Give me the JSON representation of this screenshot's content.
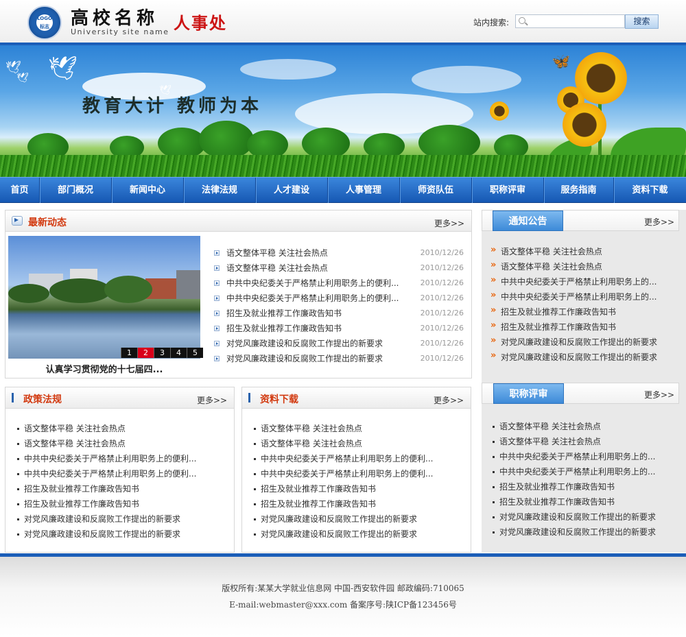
{
  "header": {
    "logo_text": "LOGO\n标志",
    "site_name": "高校名称",
    "site_name_en": "University site name",
    "department": "人事处",
    "search_label": "站内搜索:",
    "search_value": "",
    "search_button": "搜索"
  },
  "banner": {
    "slogan": "教育大计 教师为本"
  },
  "nav": [
    "首页",
    "部门概况",
    "新闻中心",
    "法律法规",
    "人才建设",
    "人事管理",
    "师资队伍",
    "职称评审",
    "服务指南",
    "资料下载"
  ],
  "latest": {
    "title": "最新动态",
    "more": "更多>>",
    "slide_caption": "认真学习贯彻党的十七届四...",
    "slide_numbers": [
      "1",
      "2",
      "3",
      "4",
      "5"
    ],
    "active_slide": "2",
    "items": [
      {
        "title": "语文整体平稳 关注社会热点",
        "date": "2010/12/26"
      },
      {
        "title": "语文整体平稳 关注社会热点",
        "date": "2010/12/26"
      },
      {
        "title": "中共中央纪委关于严格禁止利用职务上的便利...",
        "date": "2010/12/26"
      },
      {
        "title": "中共中央纪委关于严格禁止利用职务上的便利...",
        "date": "2010/12/26"
      },
      {
        "title": "招生及就业推荐工作廉政告知书",
        "date": "2010/12/26"
      },
      {
        "title": "招生及就业推荐工作廉政告知书",
        "date": "2010/12/26"
      },
      {
        "title": "对党风廉政建设和反腐败工作提出的新要求",
        "date": "2010/12/26"
      },
      {
        "title": "对党风廉政建设和反腐败工作提出的新要求",
        "date": "2010/12/26"
      }
    ]
  },
  "policy": {
    "title": "政策法规",
    "more": "更多>>",
    "items": [
      "语文整体平稳 关注社会热点",
      "语文整体平稳 关注社会热点",
      "中共中央纪委关于严格禁止利用职务上的便利...",
      "中共中央纪委关于严格禁止利用职务上的便利...",
      "招生及就业推荐工作廉政告知书",
      "招生及就业推荐工作廉政告知书",
      "对党风廉政建设和反腐败工作提出的新要求",
      "对党风廉政建设和反腐败工作提出的新要求"
    ]
  },
  "downloads": {
    "title": "资料下载",
    "more": "更多>>",
    "items": [
      "语文整体平稳 关注社会热点",
      "语文整体平稳 关注社会热点",
      "中共中央纪委关于严格禁止利用职务上的便利...",
      "中共中央纪委关于严格禁止利用职务上的便利...",
      "招生及就业推荐工作廉政告知书",
      "招生及就业推荐工作廉政告知书",
      "对党风廉政建设和反腐败工作提出的新要求",
      "对党风廉政建设和反腐败工作提出的新要求"
    ]
  },
  "notice": {
    "title": "通知公告",
    "more": "更多>>",
    "items": [
      "语文整体平稳 关注社会热点",
      "语文整体平稳 关注社会热点",
      "中共中央纪委关于严格禁止利用职务上的...",
      "中共中央纪委关于严格禁止利用职务上的...",
      "招生及就业推荐工作廉政告知书",
      "招生及就业推荐工作廉政告知书",
      "对党风廉政建设和反腐败工作提出的新要求",
      "对党风廉政建设和反腐败工作提出的新要求"
    ]
  },
  "titles": {
    "title": "职称评审",
    "more": "更多>>",
    "items": [
      "语文整体平稳 关注社会热点",
      "语文整体平稳 关注社会热点",
      "中共中央纪委关于严格禁止利用职务上的...",
      "中共中央纪委关于严格禁止利用职务上的...",
      "招生及就业推荐工作廉政告知书",
      "招生及就业推荐工作廉政告知书",
      "对党风廉政建设和反腐败工作提出的新要求",
      "对党风廉政建设和反腐败工作提出的新要求"
    ]
  },
  "footer": {
    "line1": "版权所有:某某大学就业信息网 中国-西安软件园  邮政编码:710065",
    "line2": "E-mail:webmaster@xxx.com 备案序号:陕ICP备123456号"
  },
  "colors": {
    "brand_blue": "#1b5eb8",
    "accent_red": "#d23a10",
    "department_red": "#cc1414"
  }
}
